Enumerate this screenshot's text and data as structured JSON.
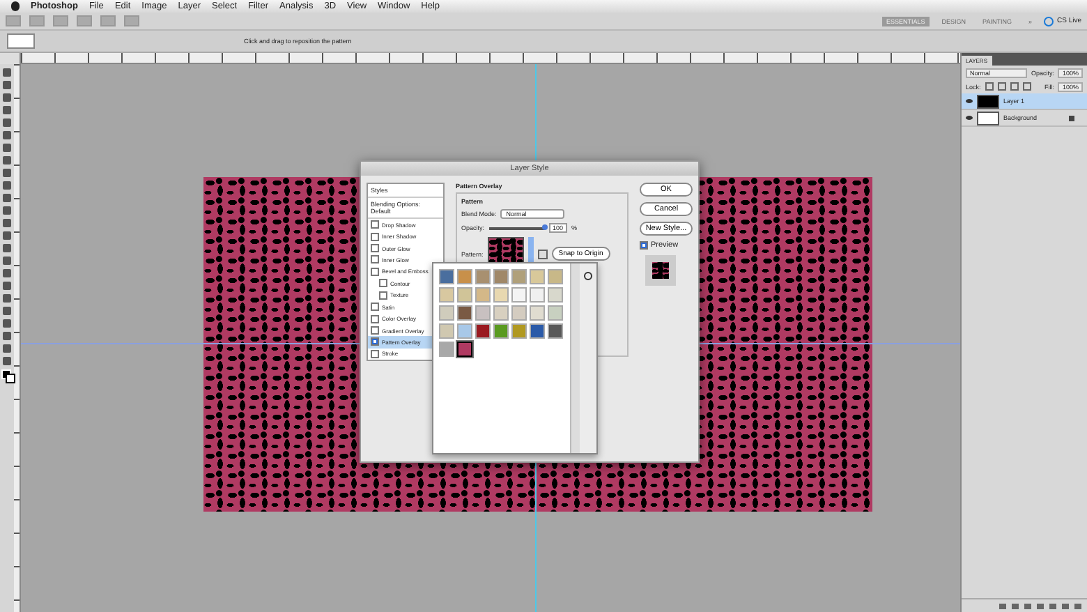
{
  "menu_bar": {
    "app_name": "Photoshop",
    "items": [
      "File",
      "Edit",
      "Image",
      "Layer",
      "Select",
      "Filter",
      "Analysis",
      "3D",
      "View",
      "Window",
      "Help"
    ]
  },
  "app_bar": {
    "workspaces": [
      {
        "label": "ESSENTIALS",
        "selected": true
      },
      {
        "label": "DESIGN",
        "selected": false
      },
      {
        "label": "PAINTING",
        "selected": false
      }
    ],
    "more": "»",
    "cs_live": "CS Live"
  },
  "options_bar": {
    "hint": "Click and drag to reposition the pattern"
  },
  "layers_panel": {
    "tabs": [
      {
        "label": "LAYERS",
        "selected": true
      }
    ],
    "blend_mode": "Normal",
    "opacity_label": "Opacity:",
    "opacity": "100%",
    "lock_label": "Lock:",
    "fill_label": "Fill:",
    "fill": "100%",
    "layers": [
      {
        "name": "Layer 1",
        "selected": true,
        "locked": false,
        "color": "#000000"
      },
      {
        "name": "Background",
        "selected": false,
        "locked": true,
        "color": "#ffffff"
      }
    ]
  },
  "dialog": {
    "title": "Layer Style",
    "headers": [
      "Styles",
      "Blending Options: Default"
    ],
    "effects": [
      {
        "label": "Drop Shadow",
        "checked": false,
        "selected": false
      },
      {
        "label": "Inner Shadow",
        "checked": false,
        "selected": false
      },
      {
        "label": "Outer Glow",
        "checked": false,
        "selected": false
      },
      {
        "label": "Inner Glow",
        "checked": false,
        "selected": false
      },
      {
        "label": "Bevel and Emboss",
        "checked": false,
        "selected": false,
        "children": [
          {
            "label": "Contour",
            "checked": false,
            "selected": false
          },
          {
            "label": "Texture",
            "checked": false,
            "selected": false
          }
        ]
      },
      {
        "label": "Satin",
        "checked": false,
        "selected": false
      },
      {
        "label": "Color Overlay",
        "checked": false,
        "selected": false
      },
      {
        "label": "Gradient Overlay",
        "checked": false,
        "selected": false
      },
      {
        "label": "Pattern Overlay",
        "checked": true,
        "selected": true
      },
      {
        "label": "Stroke",
        "checked": false,
        "selected": false
      }
    ],
    "section_title": "Pattern Overlay",
    "group_title": "Pattern",
    "blend_label": "Blend Mode:",
    "blend_mode": "Normal",
    "opacity_label": "Opacity:",
    "opacity_slider": {
      "level": 1
    },
    "opacity": "100",
    "percent": "%",
    "pattern_label": "Pattern:",
    "snap_button": "Snap to Origin",
    "buttons": [
      "OK",
      "Cancel",
      "New Style..."
    ],
    "preview": {
      "label": "Preview",
      "checked": true
    }
  },
  "pattern_picker": {
    "swatches": [
      {
        "color": "#4a6e9e",
        "selected": false
      },
      {
        "color": "#c8904a",
        "selected": false
      },
      {
        "color": "#a89070",
        "selected": false
      },
      {
        "color": "#a08868",
        "selected": false
      },
      {
        "color": "#b0a07a",
        "selected": false
      },
      {
        "color": "#d8c89a",
        "selected": false
      },
      {
        "color": "#c8b888",
        "selected": false
      },
      {
        "color": "#d8c8a0",
        "selected": false
      },
      {
        "color": "#d0c498",
        "selected": false
      },
      {
        "color": "#d4b888",
        "selected": false
      },
      {
        "color": "#e8d8b0",
        "selected": false
      },
      {
        "color": "#f4f4f4",
        "selected": false
      },
      {
        "color": "#f0f0f0",
        "selected": false
      },
      {
        "color": "#d8d8cc",
        "selected": false
      },
      {
        "color": "#d0ccbc",
        "selected": false
      },
      {
        "color": "#7a5a44",
        "selected": false
      },
      {
        "color": "#c8c0c0",
        "selected": false
      },
      {
        "color": "#d8d0c0",
        "selected": false
      },
      {
        "color": "#d4ccc0",
        "selected": false
      },
      {
        "color": "#e0dcd0",
        "selected": false
      },
      {
        "color": "#c8d0c0",
        "selected": false
      },
      {
        "color": "#d0c8b0",
        "selected": false
      },
      {
        "color": "#a8c8e8",
        "selected": false
      },
      {
        "color": "#9a1a20",
        "selected": false
      },
      {
        "color": "#5a9a20",
        "selected": false
      },
      {
        "color": "#b09820",
        "selected": false
      },
      {
        "color": "#2a5aa8",
        "selected": false
      },
      {
        "color": "#585858",
        "selected": false
      },
      {
        "color": "#a8a8a8",
        "selected": false
      },
      {
        "color": "#b03a62",
        "selected": true
      }
    ]
  }
}
